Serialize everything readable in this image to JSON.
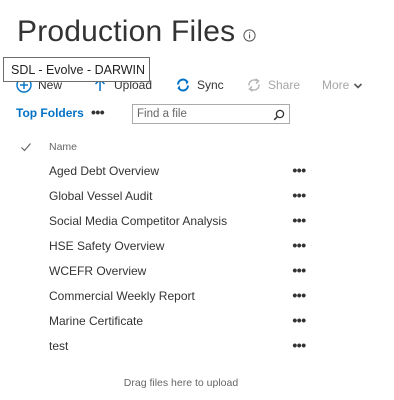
{
  "header": {
    "title": "Production Files",
    "info_icon": "info-icon"
  },
  "tooltip": {
    "text": "SDL - Evolve - DARWIN"
  },
  "toolbar": {
    "new_label": "New",
    "upload_label": "Upload",
    "sync_label": "Sync",
    "share_label": "Share",
    "more_label": "More",
    "icons": {
      "new": "plus-circle-icon",
      "upload": "upload-arrow-icon",
      "sync": "sync-icon",
      "share": "share-icon",
      "more": "chevron-down-icon"
    },
    "colors": {
      "active_text": "#333333",
      "disabled_text": "#a6a6a6",
      "accent": "#0072c6"
    }
  },
  "nav": {
    "top_folders_label": "Top Folders",
    "ellipsis": "•••"
  },
  "search": {
    "placeholder": "Find a file",
    "value": ""
  },
  "list": {
    "column_name": "Name",
    "row_menu": "•••",
    "items": [
      {
        "name": "Aged Debt Overview"
      },
      {
        "name": "Global Vessel Audit"
      },
      {
        "name": "Social Media Competitor Analysis"
      },
      {
        "name": "HSE Safety Overview"
      },
      {
        "name": "WCEFR Overview"
      },
      {
        "name": "Commercial Weekly Report"
      },
      {
        "name": "Marine Certificate"
      },
      {
        "name": "test"
      }
    ]
  },
  "footer": {
    "drop_hint": "Drag files here to upload"
  }
}
